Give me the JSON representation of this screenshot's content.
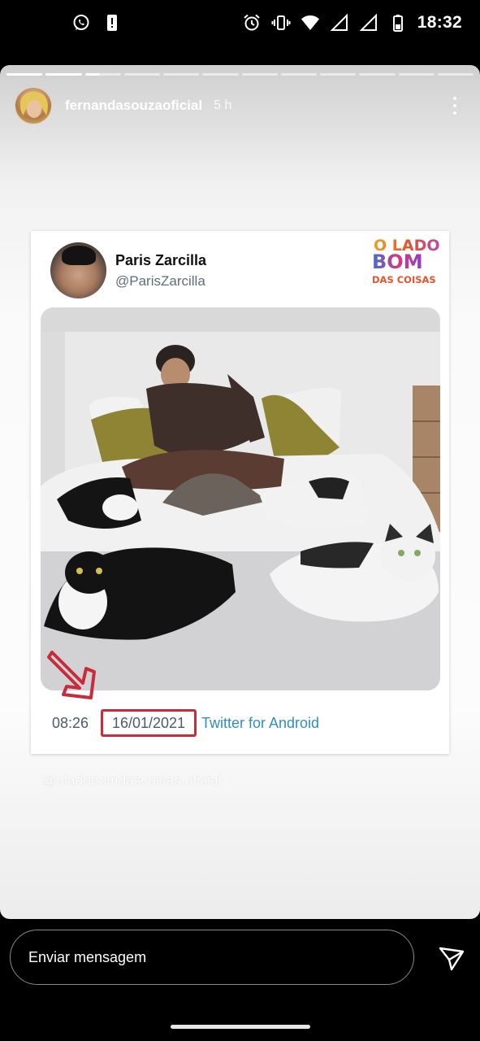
{
  "status_bar": {
    "time": "18:32",
    "left_icons": [
      "whatsapp-icon",
      "notification-alert-icon"
    ],
    "right_icons": [
      "alarm-icon",
      "vibrate-icon",
      "wifi-icon",
      "signal-icon",
      "signal-icon",
      "battery-icon"
    ]
  },
  "story": {
    "progress_total": 12,
    "progress_done": 2,
    "progress_current_fraction": 0.4,
    "username": "fernandasouzaoficial",
    "time_ago": "5 h",
    "mention": "@oladobomdascoisas.oficial"
  },
  "tweet": {
    "name": "Paris Zarcilla",
    "handle": "@ParisZarcilla",
    "time": "08:26",
    "date": "16/01/2021",
    "source": "Twitter for Android",
    "logo_text": {
      "line1": "O LADO",
      "line2": "BOM",
      "line3": "DAS COISAS"
    },
    "date_highlight_color": "#c82c3b",
    "link_color": "#2f8fbf"
  },
  "composer": {
    "placeholder": "Enviar mensagem"
  },
  "colors": {
    "background": "#000000",
    "story_text": "#ffffff"
  }
}
